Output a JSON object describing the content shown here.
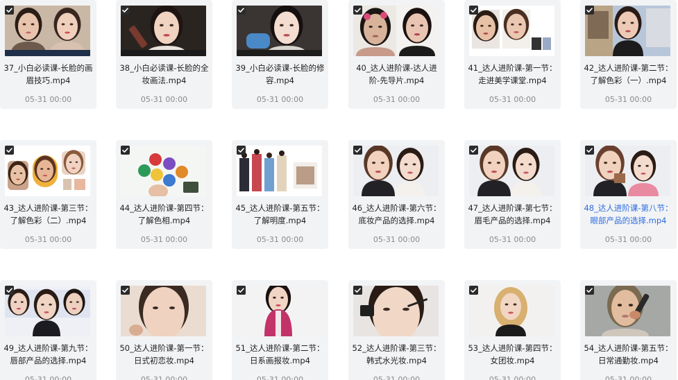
{
  "accent_color": "#2d6cdf",
  "files": [
    {
      "name": "37_小白必读课-长脸的画眉技巧.mp4",
      "date": "05-31 00:00",
      "checked": true,
      "selected": false,
      "thumb": "two-faces"
    },
    {
      "name": "38_小白必读课-长脸的全妆画法.mp4",
      "date": "05-31 00:00",
      "checked": true,
      "selected": false,
      "thumb": "lipstick"
    },
    {
      "name": "39_小白必读课-长脸的修容.mp4",
      "date": "05-31 00:00",
      "checked": true,
      "selected": false,
      "thumb": "contour"
    },
    {
      "name": "40_达人进阶课-达人进阶-先导片.mp4",
      "date": "05-31 00:00",
      "checked": true,
      "selected": false,
      "thumb": "before-after"
    },
    {
      "name": "41_达人进阶课-第一节：走进美学课堂.mp4",
      "date": "05-31 00:00",
      "checked": true,
      "selected": false,
      "thumb": "slide-faces"
    },
    {
      "name": "42_达人进阶课-第二节：了解色彩（一）.mp4",
      "date": "05-31 00:00",
      "checked": true,
      "selected": false,
      "thumb": "presenter-art"
    },
    {
      "name": "43_达人进阶课-第三节：了解色彩（二）.mp4",
      "date": "05-31 00:00",
      "checked": true,
      "selected": false,
      "thumb": "color-slide"
    },
    {
      "name": "44_达人进阶课-第四节：了解色相.mp4",
      "date": "05-31 00:00",
      "checked": true,
      "selected": false,
      "thumb": "palette"
    },
    {
      "name": "45_达人进阶课-第五节：了解明度.mp4",
      "date": "05-31 00:00",
      "checked": true,
      "selected": false,
      "thumb": "outfits"
    },
    {
      "name": "46_达人进阶课-第六节：底妆产品的选择.mp4",
      "date": "05-31 00:00",
      "checked": true,
      "selected": false,
      "thumb": "two-women"
    },
    {
      "name": "47_达人进阶课-第七节：眉毛产品的选择.mp4",
      "date": "05-31 00:00",
      "checked": true,
      "selected": false,
      "thumb": "two-women"
    },
    {
      "name": "48_达人进阶课-第八节：眼部产品的选择.mp4",
      "date": "05-31 00:00",
      "checked": true,
      "selected": true,
      "thumb": "two-women-palette"
    },
    {
      "name": "49_达人进阶课-第九节：唇部产品的选择.mp4",
      "date": "05-31 00:00",
      "checked": true,
      "selected": false,
      "thumb": "presenter-screen"
    },
    {
      "name": "50_达人进阶课-第一节：日式初恋妆.mp4",
      "date": "05-31 00:00",
      "checked": true,
      "selected": false,
      "thumb": "face-closeup"
    },
    {
      "name": "51_达人进阶课-第二节：日系画报妆.mp4",
      "date": "05-31 00:00",
      "checked": true,
      "selected": false,
      "thumb": "pink-coat"
    },
    {
      "name": "52_达人进阶课-第三节：韩式水光妆.mp4",
      "date": "05-31 00:00",
      "checked": true,
      "selected": false,
      "thumb": "eye-makeup"
    },
    {
      "name": "53_达人进阶课-第四节：女团妆.mp4",
      "date": "05-31 00:00",
      "checked": true,
      "selected": false,
      "thumb": "blonde"
    },
    {
      "name": "54_达人进阶课-第五节：日常通勤妆.mp4",
      "date": "05-31 00:00",
      "checked": true,
      "selected": false,
      "thumb": "brush"
    }
  ]
}
